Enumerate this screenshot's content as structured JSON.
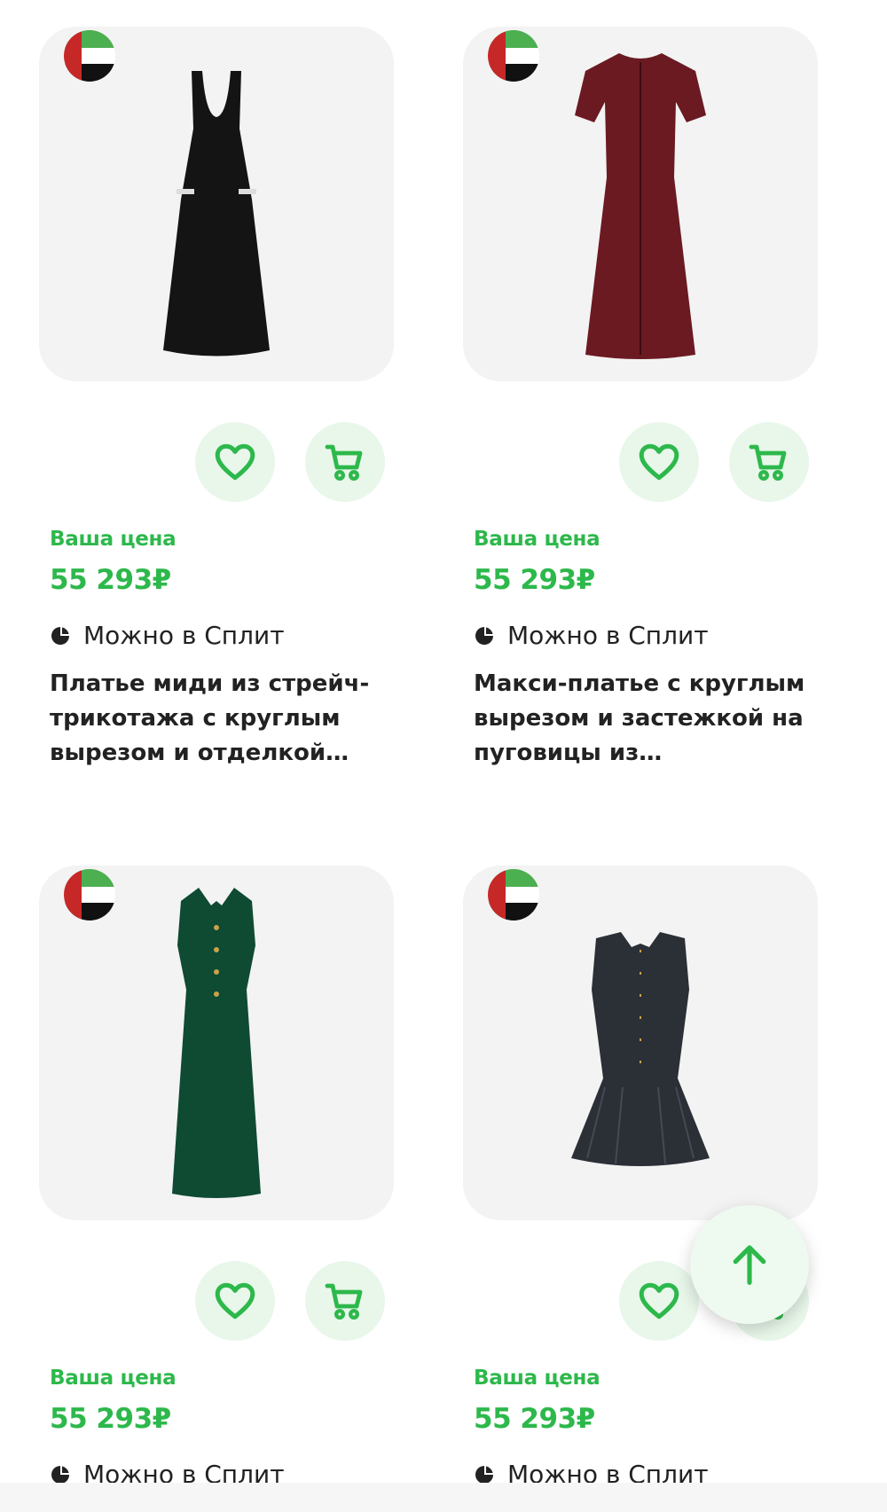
{
  "colors": {
    "accent": "#2db84b",
    "accent_bg": "#e8f7ea",
    "card_bg": "#f3f3f3",
    "text": "#222222"
  },
  "products": [
    {
      "price_label": "Ваша цена",
      "price": "55 293₽",
      "split_text": "Можно в Сплит",
      "title": "Платье миди из стрейч-трикотажа с круглым вырезом и отделкой…",
      "flag_icon": "uae-flag-icon",
      "dress_color": "#141414"
    },
    {
      "price_label": "Ваша цена",
      "price": "55 293₽",
      "split_text": "Можно в Сплит",
      "title": "Макси-платье с круглым вырезом и застежкой на пуговицы из…",
      "flag_icon": "uae-flag-icon",
      "dress_color": "#6b1a22"
    },
    {
      "price_label": "Ваша цена",
      "price": "55 293₽",
      "split_text": "Можно в Сплит",
      "title": "",
      "flag_icon": "uae-flag-icon",
      "dress_color": "#0f4a33"
    },
    {
      "price_label": "Ваша цена",
      "price": "55 293₽",
      "split_text": "Можно в Сплит",
      "title": "",
      "flag_icon": "uae-flag-icon",
      "dress_color": "#2b2f36"
    }
  ],
  "scroll_top_icon": "arrow-up-icon"
}
